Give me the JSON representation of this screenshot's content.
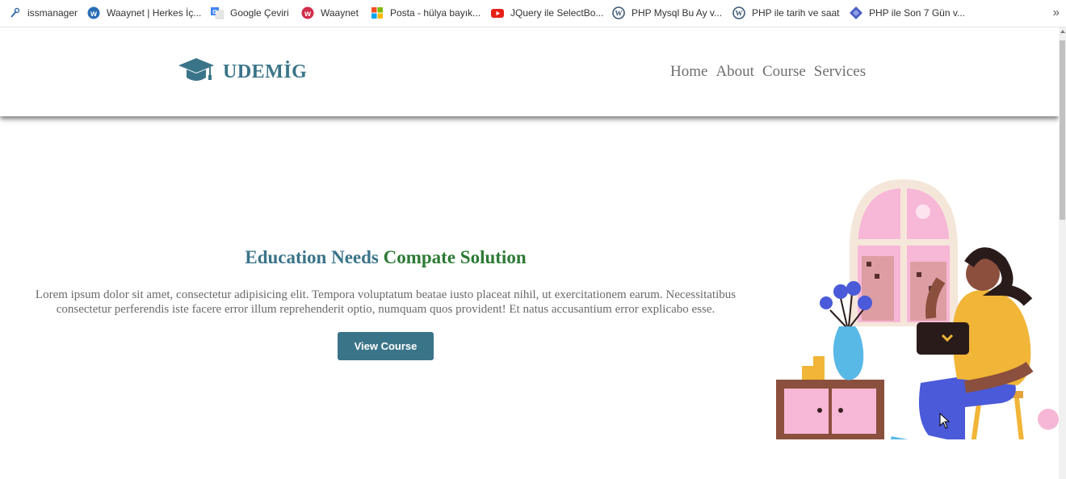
{
  "bookmarks": [
    {
      "label": "issmanager",
      "icon": "wrench-icon"
    },
    {
      "label": "Waaynet | Herkes İç...",
      "icon": "waaynet-blue-icon"
    },
    {
      "label": "Google Çeviri",
      "icon": "google-translate-icon"
    },
    {
      "label": "Waaynet",
      "icon": "waaynet-red-icon"
    },
    {
      "label": "Posta - hülya bayık...",
      "icon": "microsoft-icon"
    },
    {
      "label": "JQuery ile SelectBo...",
      "icon": "youtube-icon"
    },
    {
      "label": "PHP Mysql Bu Ay v...",
      "icon": "wordpress-icon"
    },
    {
      "label": "PHP ile tarih ve saat",
      "icon": "wordpress-icon"
    },
    {
      "label": "PHP ile Son 7 Gün v...",
      "icon": "diamond-icon"
    }
  ],
  "bookmarks_overflow": "»",
  "site": {
    "logo_text": "UDEMİG",
    "nav": [
      "Home",
      "About",
      "Course",
      "Services"
    ]
  },
  "hero": {
    "title_part1": "Education Needs",
    "title_part2": "Compate Solution",
    "paragraph_line1": "Lorem ipsum dolor sit amet, consectetur adipisicing elit. Tempora voluptatum beatae iusto placeat nihil, ut exercitationem earum. Necessitatibus",
    "paragraph_line2": "consectetur perferendis iste facere error illum reprehenderit optio, numquam quos provident! Et natus accusantium error explicabo esse.",
    "button_label": "View Course"
  },
  "colors": {
    "brand": "#3a7489",
    "accent_green": "#2c7a34",
    "text_gray": "#6a6a6a"
  }
}
